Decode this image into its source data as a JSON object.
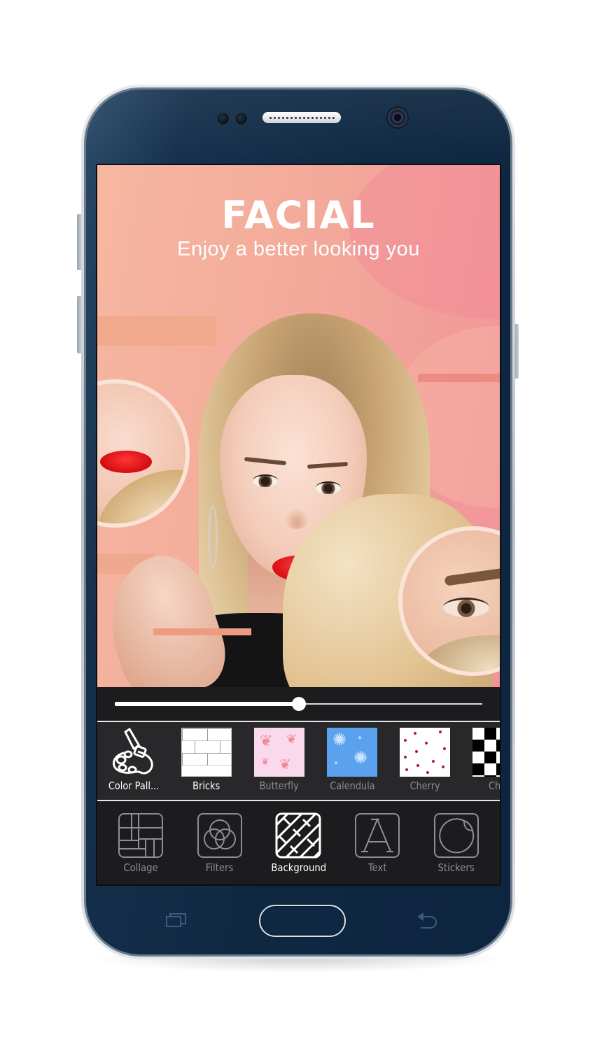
{
  "device": {
    "type": "android-phone",
    "hardware_keys": {
      "recent_icon": "recent-apps-icon",
      "home_icon": "home-button",
      "back_icon": "back-arrow-icon"
    }
  },
  "promo": {
    "title": "FACIAL",
    "subtitle": "Enjoy a better looking you",
    "colors": {
      "background_start": "#f6b7a1",
      "background_end": "#f1939a",
      "lips": "#d80f16"
    }
  },
  "slider": {
    "value": 0.5,
    "track_color": "#d9d9d9",
    "thumb_color": "#ffffff"
  },
  "background_options": [
    {
      "label": "Color Pall...",
      "icon": "color-palette-icon",
      "state": "active"
    },
    {
      "label": "Bricks",
      "icon": "bricks-pattern",
      "state": "active"
    },
    {
      "label": "Butterfly",
      "icon": "butterfly-pattern",
      "state": "inactive"
    },
    {
      "label": "Calendula",
      "icon": "calendula-pattern",
      "state": "inactive"
    },
    {
      "label": "Cherry",
      "icon": "cherry-pattern",
      "state": "inactive"
    },
    {
      "label": "Che",
      "icon": "checker-pattern",
      "state": "inactive"
    }
  ],
  "toolbar": {
    "selected": "Background",
    "items": [
      {
        "label": "Collage",
        "icon": "collage-icon"
      },
      {
        "label": "Filters",
        "icon": "filters-icon"
      },
      {
        "label": "Background",
        "icon": "background-icon"
      },
      {
        "label": "Text",
        "icon": "text-icon"
      },
      {
        "label": "Stickers",
        "icon": "sticker-icon"
      }
    ]
  },
  "colors": {
    "bezel": "#0f2842",
    "panel_dark": "#1c1c1e",
    "panel_mid": "#28282b",
    "active_text": "#ffffff",
    "inactive_text": "#8f8f93"
  }
}
